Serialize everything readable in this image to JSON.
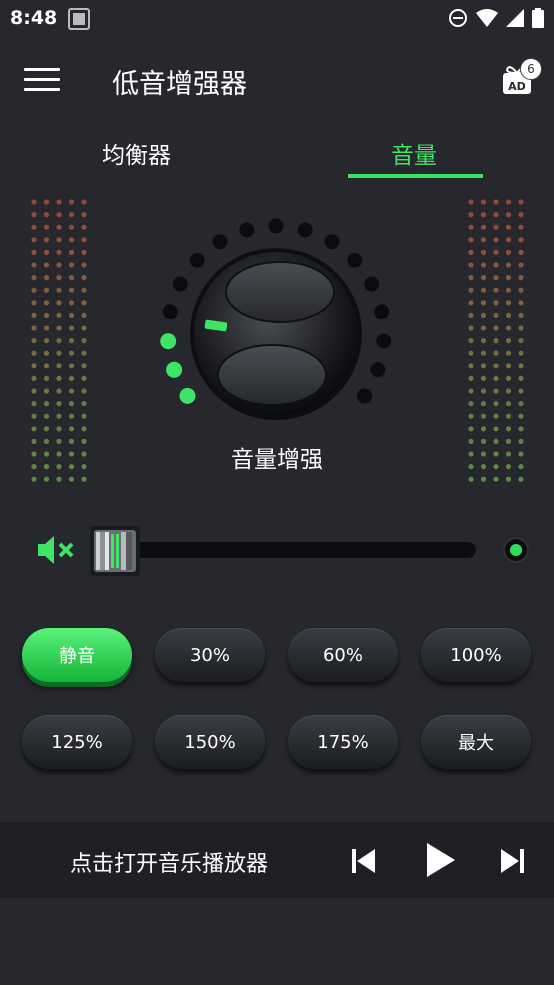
{
  "status_bar": {
    "time": "8:48"
  },
  "app_bar": {
    "title": "低音增强器",
    "ad_label": "AD",
    "ad_badge": "6"
  },
  "tabs": [
    {
      "label": "均衡器",
      "active": false
    },
    {
      "label": "音量",
      "active": true
    }
  ],
  "knob": {
    "label": "音量增强",
    "active_dots": 3,
    "total_dots": 17
  },
  "slider": {
    "value": 0
  },
  "presets": [
    "静音",
    "30%",
    "60%",
    "100%",
    "125%",
    "150%",
    "175%",
    "最大"
  ],
  "active_preset": "静音",
  "player": {
    "label": "点击打开音乐播放器"
  },
  "colors": {
    "accent": "#3ee466",
    "background": "#26282d",
    "panel": "#1e2024"
  },
  "icons": [
    "menu-icon",
    "gift-ad-icon",
    "mute-speaker-icon",
    "previous-icon",
    "play-icon",
    "next-icon"
  ]
}
